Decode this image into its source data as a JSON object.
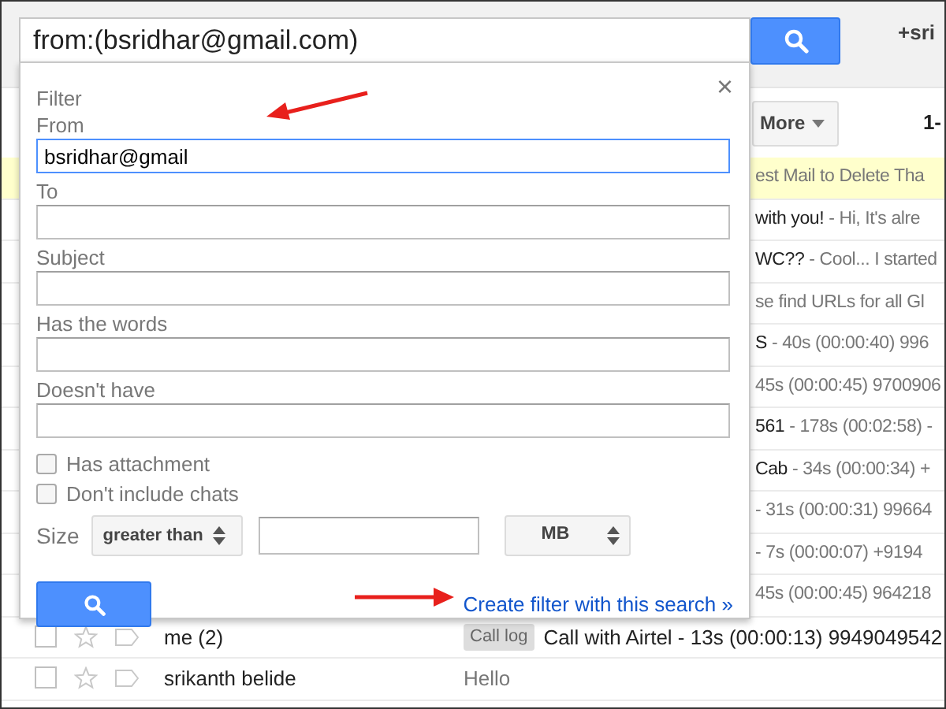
{
  "search": {
    "value": "from:(bsridhar@gmail.com)"
  },
  "account": "+sri",
  "toolbar": {
    "more": "More",
    "range": "1-"
  },
  "messages": [
    {
      "kind": "covered",
      "highlighted": true,
      "text": "est Mail to Delete Tha"
    },
    {
      "kind": "covered",
      "highlighted": false,
      "text": "**with you!** - Hi, It's alre"
    },
    {
      "kind": "covered",
      "highlighted": false,
      "text": "**WC??** - Cool... I started"
    },
    {
      "kind": "covered",
      "highlighted": false,
      "text": "se find URLs for all Gl"
    },
    {
      "kind": "covered",
      "highlighted": false,
      "text": "**S** - 40s (00:00:40) 996"
    },
    {
      "kind": "covered",
      "highlighted": false,
      "text": "45s (00:00:45) 9700906"
    },
    {
      "kind": "covered",
      "highlighted": false,
      "text": "**561** - 178s (00:02:58) -"
    },
    {
      "kind": "covered",
      "highlighted": false,
      "text": "**Cab** - 34s (00:00:34) +"
    },
    {
      "kind": "covered",
      "highlighted": false,
      "text": "- 31s (00:00:31) 99664"
    },
    {
      "kind": "covered",
      "highlighted": false,
      "text": "- 7s (00:00:07) +9194"
    },
    {
      "kind": "covered",
      "highlighted": false,
      "text": "45s (00:00:45) 964218"
    },
    {
      "kind": "full",
      "highlighted": false,
      "sender": "me (2)",
      "tag": "Call log",
      "text": "Call with Airtel - 13s (00:00:13) 9949049542"
    },
    {
      "kind": "full",
      "highlighted": false,
      "sender": "srikanth belide",
      "text": "Hello"
    }
  ],
  "filter": {
    "title": "Filter",
    "close": "×",
    "fields": [
      {
        "label": "From",
        "value": "bsridhar@gmail",
        "focused": true
      },
      {
        "label": "To",
        "focused": false
      },
      {
        "label": "Subject",
        "focused": false
      },
      {
        "label": "Has the words",
        "focused": false
      },
      {
        "label": "Doesn't have",
        "focused": false
      }
    ],
    "checkboxes": [
      {
        "label": "Has attachment",
        "checked": false
      },
      {
        "label": "Don't include chats",
        "checked": false
      }
    ],
    "size": {
      "label": "Size",
      "operator": "greater than",
      "unit": "MB"
    },
    "create_link": "Create filter with this search »"
  }
}
